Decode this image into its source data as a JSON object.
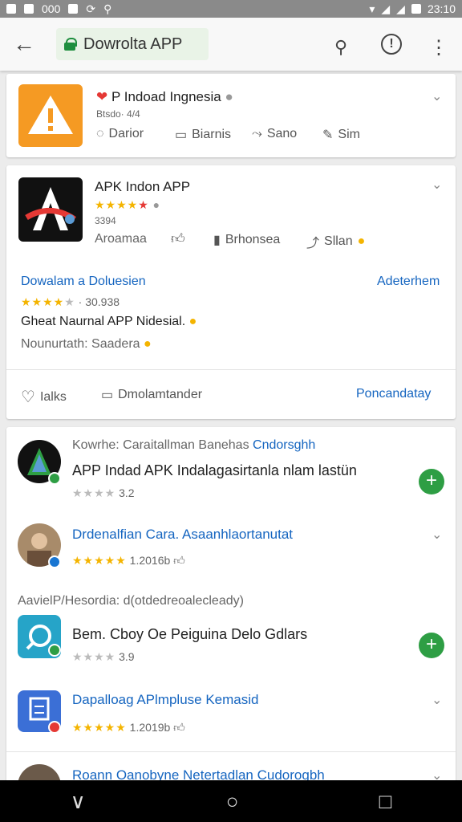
{
  "status": {
    "left_text": "000",
    "time": "23:10"
  },
  "toolbar": {
    "url_title": "Dowrolta APP"
  },
  "card1": {
    "title": "P Indoad Ingnesia",
    "meta": "Btsdo· 4/4",
    "actions": [
      "Darior",
      "Biarnis",
      "Sano",
      "Sim"
    ]
  },
  "card2": {
    "title": "APK Indon APP",
    "rating": 4,
    "meta": "3394",
    "actions": [
      "Aroamaa",
      "Brhonsea",
      "Sllan"
    ],
    "section_title": "Dowalam a Doluesien",
    "section_link": "Adeterhem",
    "section_stars": 4,
    "section_count": "30.938",
    "desc1": "Gheat Naurnal APP Nidesial.",
    "desc2": "Nounurtath: Saadera",
    "footer_left1": "Ialks",
    "footer_left2": "Dmolamtander",
    "footer_right": "Poncandatay"
  },
  "list": {
    "header1": "Kowrhe: Caraitallman Banehas",
    "header1_link": "Cndorsghh",
    "item1_title": "APP Indad APK Indalagasirtanla nlam lastün",
    "item1_rating": 3,
    "item1_count": "3.2",
    "item2_title": "Drdenalfian Cara. Asaanhlaortanutat",
    "item2_rating": 5,
    "item2_count": "1.2016b",
    "subheader": "AavielP/Hesordia: d(otdedreoalecleady)",
    "item3_title": "Bem. Cboy Oe Peiguina Delo Gdlars",
    "item3_rating": 3,
    "item3_count": "3.9",
    "item4_title": "Dapalloag APlmpluse Kemasid",
    "item4_rating": 5,
    "item4_count": "1.2019b",
    "item5_title": "Roann Oanobyne Netertadlan Cudorogbh"
  },
  "colors": {
    "green": "#2e9e44",
    "blue": "#1565c0",
    "star": "#f4b400",
    "orange": "#f59a23"
  }
}
